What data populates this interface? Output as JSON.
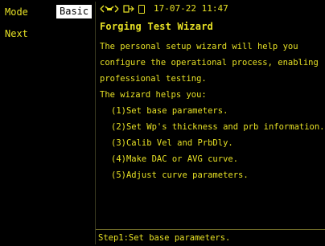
{
  "sidebar": {
    "mode_label": "Mode",
    "mode_value": "Basic",
    "next_label": "Next"
  },
  "status": {
    "datetime": "17-07-22 11:47",
    "icons": [
      "probe-link-icon",
      "transducer-icon",
      "battery-icon"
    ]
  },
  "wizard": {
    "title": "Forging Test Wizard",
    "intro_lines": [
      "The personal setup wizard will help you",
      "configure the operational process, enabling",
      "professional testing."
    ],
    "helps_label": "The wizard helps you:",
    "steps": [
      "(1)Set base parameters.",
      "(2)Set Wp's thickness and prb information.",
      "(3)Calib Vel and PrbDly.",
      "(4)Make DAC or AVG curve.",
      "(5)Adjust curve parameters."
    ]
  },
  "footer": {
    "text": "Step1:Set base parameters."
  },
  "colors": {
    "text": "#e6e025",
    "background": "#000000",
    "selected_bg": "#ffffff"
  }
}
